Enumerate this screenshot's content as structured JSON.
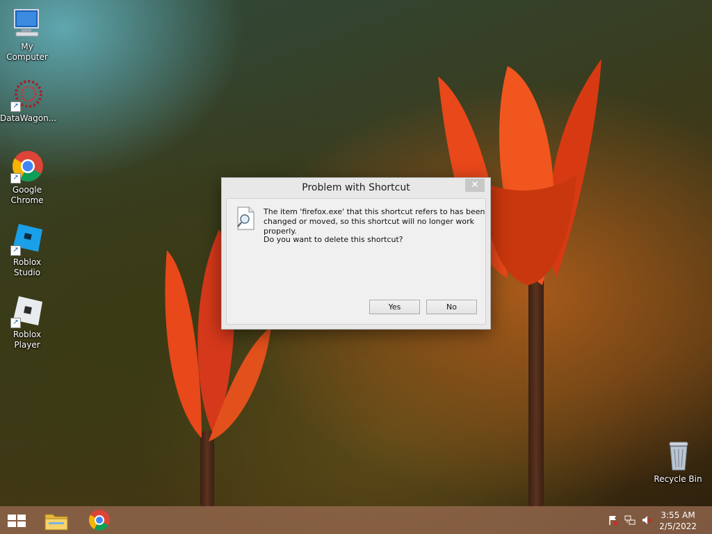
{
  "desktop": {
    "icons": [
      {
        "label": "My Computer",
        "icon": "computer-icon"
      },
      {
        "label": "DataWagon...",
        "icon": "datawagon-icon"
      },
      {
        "label": "Google Chrome",
        "icon": "chrome-icon"
      },
      {
        "label": "Roblox Studio",
        "icon": "roblox-studio-icon"
      },
      {
        "label": "Roblox Player",
        "icon": "roblox-player-icon"
      },
      {
        "label": "Recycle Bin",
        "icon": "recycle-bin-icon"
      }
    ]
  },
  "dialog": {
    "title": "Problem with Shortcut",
    "close_glyph": "✕",
    "message": "The item 'firefox.exe' that this shortcut refers to has been changed or moved, so this shortcut will no longer work properly.",
    "question": "Do you want to delete this shortcut?",
    "yes_label": "Yes",
    "no_label": "No"
  },
  "taskbar": {
    "pinned": [
      "start-icon",
      "file-explorer-icon",
      "chrome-icon"
    ],
    "tray": [
      "action-center-flag-icon",
      "network-icon",
      "volume-muted-icon"
    ],
    "time": "3:55 AM",
    "date": "2/5/2022"
  },
  "colors": {
    "taskbar": "#966950",
    "dialog_bg": "#e8e8e8",
    "close_button": "#c7c7c7"
  }
}
